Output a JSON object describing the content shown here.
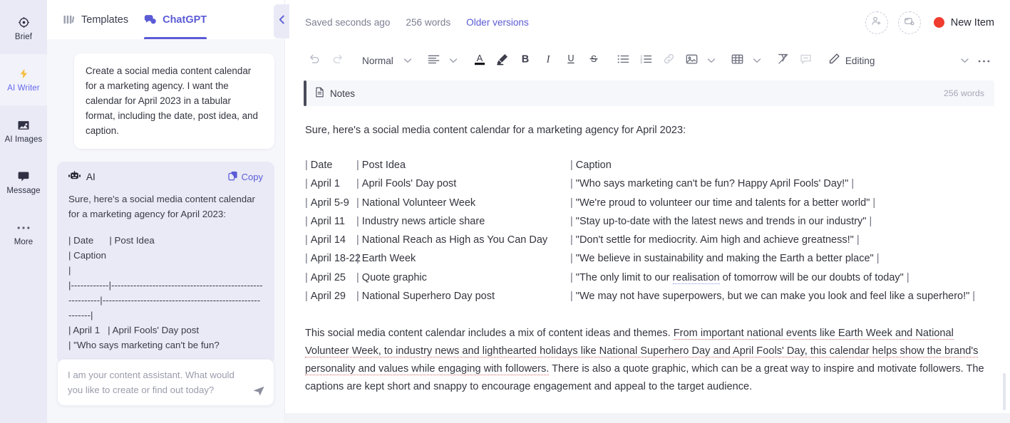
{
  "rail": {
    "items": [
      {
        "label": "Brief",
        "icon": "target-icon",
        "active": false
      },
      {
        "label": "AI Writer",
        "icon": "lightning-bolt-icon",
        "active": true
      },
      {
        "label": "AI Images",
        "icon": "image-icon",
        "active": false
      },
      {
        "label": "Message",
        "icon": "chat-bubble-icon",
        "active": false
      },
      {
        "label": "More",
        "icon": "ellipsis-icon",
        "active": false
      }
    ]
  },
  "chat": {
    "tabs": [
      {
        "label": "Templates",
        "icon": "templates-grid-icon",
        "active": false
      },
      {
        "label": "ChatGPT",
        "icon": "chat-bubbles-icon",
        "active": true
      }
    ],
    "collapse_icon": "chevron-left-icon",
    "user_message": "Create a social media content calendar for a marketing agency. I want the calendar for April 2023 in a tabular format, including the date, post idea, and caption.",
    "ai_label": "AI",
    "ai_icon": "robot-icon",
    "copy_label": "Copy",
    "copy_icon": "copy-icon",
    "ai_intro": "Sure, here's a social media content calendar for a marketing agency for April 2023:",
    "ai_table_text": "| Date      | Post Idea\n| Caption\n|\n|------------|----------------------------------------------------------|---------------------------------------------------------|\n| April 1   | April Fools' Day post\n| \"Who says marketing can't be fun?",
    "input_placeholder": "I am your content assistant. What would you like to create or find out today?",
    "send_icon": "send-icon"
  },
  "editor": {
    "saved_label": "Saved seconds ago",
    "word_count": "256 words",
    "older_versions_label": "Older versions",
    "invite_icon": "add-person-icon",
    "media_icon": "add-media-icon",
    "new_item_label": "New Item",
    "accent_color": "#5b5bd6",
    "new_item_dot_color": "#f03b2f"
  },
  "toolbar": {
    "undo_icon": "undo-icon",
    "redo_icon": "redo-icon",
    "style_label": "Normal",
    "style_caret_icon": "chevron-down-icon",
    "align_icon": "align-left-icon",
    "align_caret_icon": "chevron-down-icon",
    "text_color_icon": "text-color-icon",
    "highlight_icon": "highlighter-icon",
    "bold_icon": "bold-icon",
    "italic_icon": "italic-icon",
    "underline_icon": "underline-icon",
    "strikethrough_icon": "strikethrough-icon",
    "bullet_list_icon": "bullet-list-icon",
    "numbered_list_icon": "numbered-list-icon",
    "link_icon": "link-icon",
    "image_icon": "image-insert-icon",
    "image_caret_icon": "chevron-down-icon",
    "table_icon": "table-icon",
    "table_caret_icon": "chevron-down-icon",
    "clear_format_icon": "clear-formatting-icon",
    "comment_icon": "comment-icon",
    "editing_icon": "pencil-icon",
    "editing_label": "Editing",
    "editing_caret_icon": "chevron-down-icon",
    "more_icon": "ellipsis-icon"
  },
  "notes": {
    "icon": "document-icon",
    "title": "Notes",
    "word_count": "256 words"
  },
  "document": {
    "lead": "Sure, here's a social media content calendar for a marketing agency for April 2023:",
    "table_rows": [
      {
        "date": "Date",
        "idea": "Post Idea",
        "caption": "Caption",
        "caption_end": ""
      },
      {
        "date": "April 1",
        "idea": "April Fools' Day post",
        "caption": "\"Who says marketing can't be fun? Happy April Fools' Day!\"",
        "caption_end": "|"
      },
      {
        "date": "April 5-9",
        "idea": "National Volunteer Week",
        "caption": "\"We're proud to volunteer our time and talents for a better world\"",
        "caption_end": "|"
      },
      {
        "date": "April 11",
        "idea": "Industry news article share",
        "caption": "\"Stay up-to-date with the latest news and trends in our industry\"",
        "caption_end": "|"
      },
      {
        "date": "April 14",
        "idea": "National Reach as High as You Can Day",
        "caption": "\"Don't settle for mediocrity. Aim high and achieve greatness!\"",
        "caption_end": "|"
      },
      {
        "date": "April 18-22",
        "idea": "Earth Week",
        "caption": "\"We believe in sustainability and making the Earth a better place\"",
        "caption_end": "|"
      },
      {
        "date": "April 25",
        "idea": "Quote graphic",
        "caption": "\"The only limit to our realisation of tomorrow will be our doubts of today\"",
        "caption_end": "|",
        "spellcheck_word": "realisation"
      },
      {
        "date": "April 29",
        "idea": "National Superhero Day post",
        "caption": "\"We may not have superpowers, but we can make you look and feel like a superhero!\"",
        "caption_end": "|"
      }
    ],
    "summary_plain_1": "This social media content calendar includes a mix of content ideas and themes. ",
    "summary_flagged": "From important national events like Earth Week and National Volunteer Week, to industry news and lighthearted holidays like National Superhero Day and April Fools' Day, this calendar helps show the brand's personality and values while engaging with followers.",
    "summary_plain_2": " There is also a quote graphic, which can be a great way to inspire and motivate followers. The captions are kept short and snappy to encourage engagement and appeal to the target audience."
  }
}
